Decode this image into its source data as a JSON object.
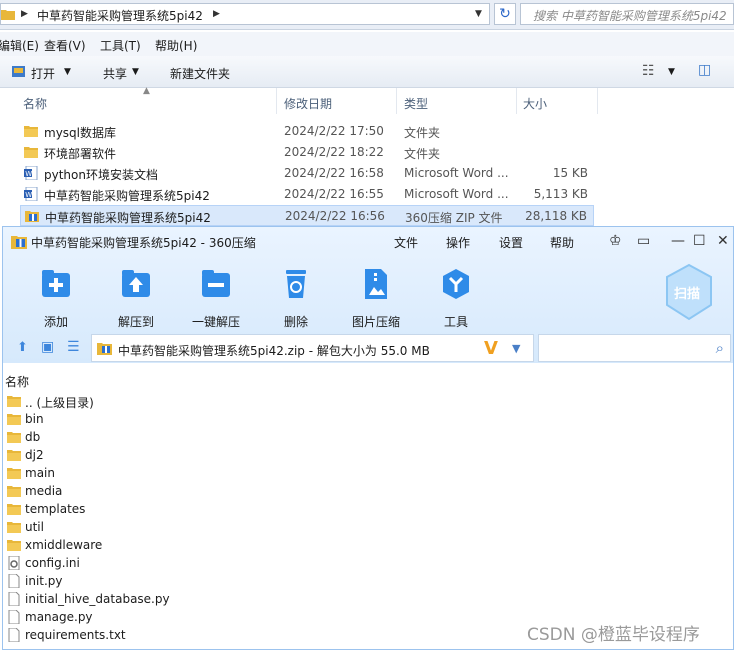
{
  "explorer": {
    "breadcrumb": "中草药智能采购管理系统5pi42",
    "search_placeholder": "搜索 中草药智能采购管理系统5pi42",
    "menu": [
      "编辑(E)",
      "查看(V)",
      "工具(T)",
      "帮助(H)"
    ],
    "toolbar": {
      "open": "打开",
      "share": "共享",
      "new_folder": "新建文件夹"
    },
    "columns": {
      "name": "名称",
      "date": "修改日期",
      "type": "类型",
      "size": "大小"
    },
    "files": [
      {
        "name": "mysql数据库",
        "date": "2024/2/22 17:50",
        "type": "文件夹",
        "size": "",
        "icon": "folder-icon"
      },
      {
        "name": "环境部署软件",
        "date": "2024/2/22 18:22",
        "type": "文件夹",
        "size": "",
        "icon": "folder-icon"
      },
      {
        "name": "python环境安装文档",
        "date": "2024/2/22 16:58",
        "type": "Microsoft Word ...",
        "size": "15 KB",
        "icon": "word-doc-icon"
      },
      {
        "name": "中草药智能采购管理系统5pi42",
        "date": "2024/2/22 16:55",
        "type": "Microsoft Word ...",
        "size": "5,113 KB",
        "icon": "word-doc-icon"
      },
      {
        "name": "中草药智能采购管理系统5pi42",
        "date": "2024/2/22 16:56",
        "type": "360压缩 ZIP 文件",
        "size": "28,118 KB",
        "icon": "zip-archive-icon",
        "selected": true
      }
    ]
  },
  "zip": {
    "title": "中草药智能采购管理系统5pi42 - 360压缩",
    "menu": [
      "文件",
      "操作",
      "设置",
      "帮助"
    ],
    "tools": [
      {
        "label": "添加",
        "icon": "add-icon"
      },
      {
        "label": "解压到",
        "icon": "extract-to-icon"
      },
      {
        "label": "一键解压",
        "icon": "one-click-extract-icon"
      },
      {
        "label": "删除",
        "icon": "delete-icon"
      },
      {
        "label": "图片压缩",
        "icon": "image-compress-icon"
      },
      {
        "label": "工具",
        "icon": "tools-icon"
      }
    ],
    "scan_label": "扫描",
    "path": "中草药智能采购管理系统5pi42.zip - 解包大小为 55.0 MB",
    "column_name": "名称",
    "entries": [
      {
        "name": ".. (上级目录)",
        "icon": "folder-icon"
      },
      {
        "name": "bin",
        "icon": "folder-icon"
      },
      {
        "name": "db",
        "icon": "folder-icon"
      },
      {
        "name": "dj2",
        "icon": "folder-icon"
      },
      {
        "name": "main",
        "icon": "folder-icon"
      },
      {
        "name": "media",
        "icon": "folder-icon"
      },
      {
        "name": "templates",
        "icon": "folder-icon"
      },
      {
        "name": "util",
        "icon": "folder-icon"
      },
      {
        "name": "xmiddleware",
        "icon": "folder-icon"
      },
      {
        "name": "config.ini",
        "icon": "settings-file-icon"
      },
      {
        "name": "init.py",
        "icon": "file-icon"
      },
      {
        "name": "initial_hive_database.py",
        "icon": "file-icon"
      },
      {
        "name": "manage.py",
        "icon": "file-icon"
      },
      {
        "name": "requirements.txt",
        "icon": "file-icon"
      }
    ]
  },
  "watermark": "CSDN @橙蓝毕设程序"
}
